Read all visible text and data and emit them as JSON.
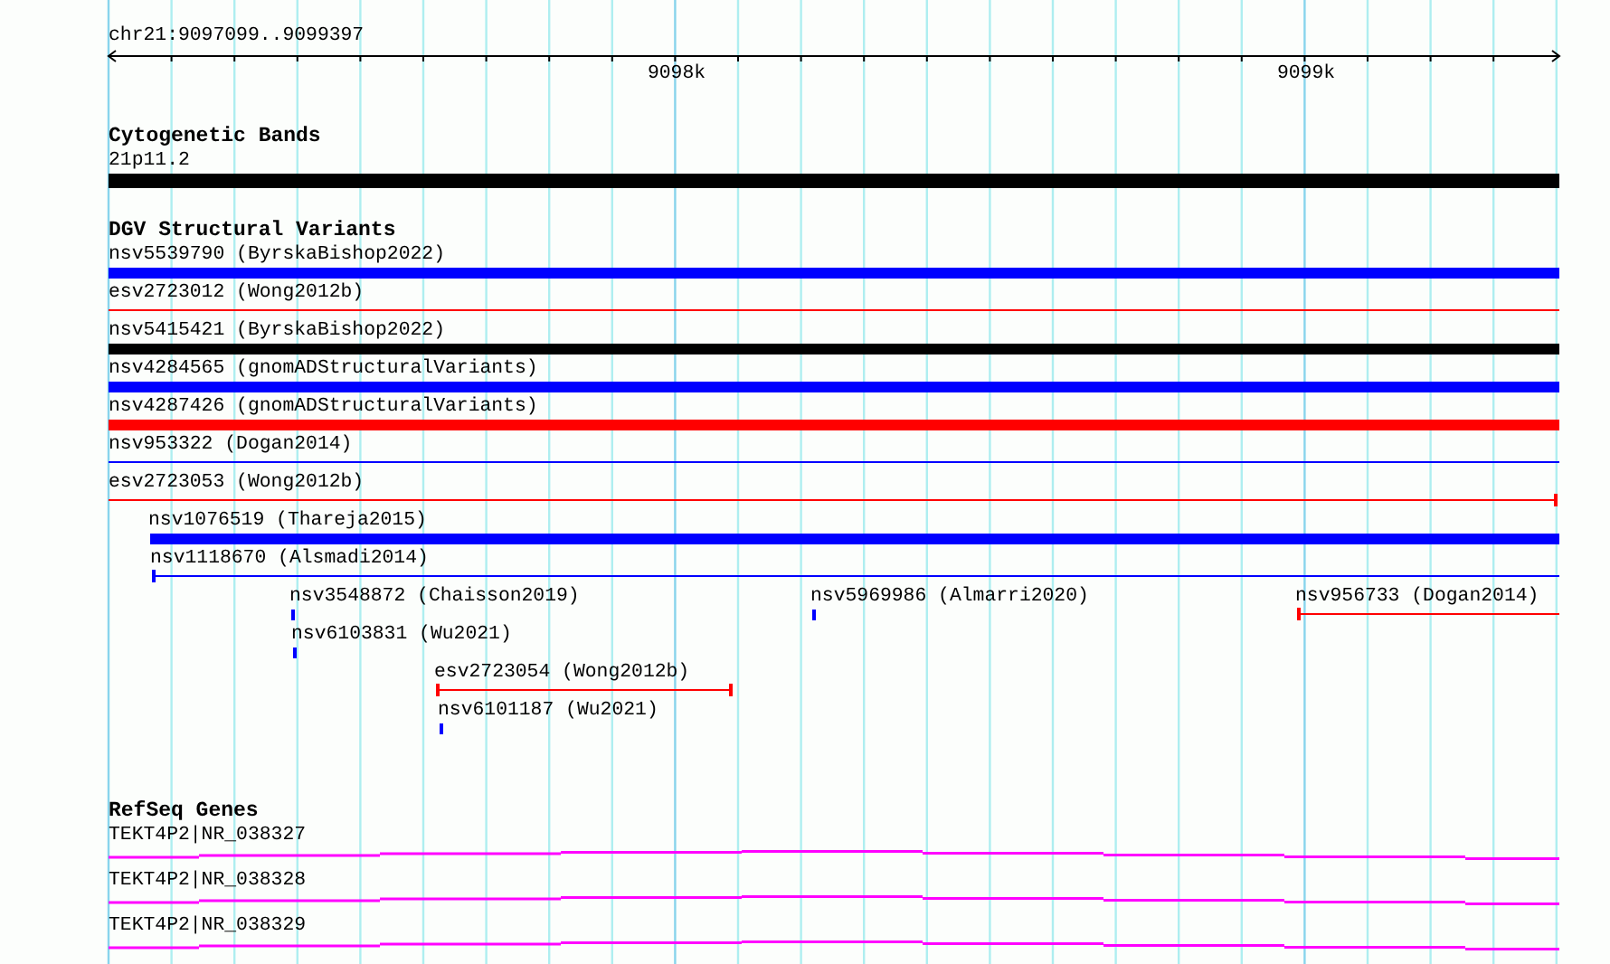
{
  "ruler": {
    "location": "chr21:9097099..9099397",
    "tick_labels": [
      "9098k",
      "9099k"
    ]
  },
  "tracks": [
    {
      "title": "Cytogenetic Bands",
      "rows": [
        [
          {
            "label": "21p11.2",
            "kind": "band",
            "color": "#000000"
          }
        ]
      ]
    },
    {
      "title": "DGV Structural Variants",
      "rows": [
        [
          {
            "label": "nsv5539790 (ByrskaBishop2022)",
            "kind": "thick",
            "color": "#0000ff"
          }
        ],
        [
          {
            "label": "esv2723012 (Wong2012b)",
            "kind": "line",
            "color": "#ff0000"
          }
        ],
        [
          {
            "label": "nsv5415421 (ByrskaBishop2022)",
            "kind": "thick",
            "color": "#000000"
          }
        ],
        [
          {
            "label": "nsv4284565 (gnomADStructuralVariants)",
            "kind": "thick",
            "color": "#0000ff"
          }
        ],
        [
          {
            "label": "nsv4287426 (gnomADStructuralVariants)",
            "kind": "thick",
            "color": "#ff0000"
          }
        ],
        [
          {
            "label": "nsv953322 (Dogan2014)",
            "kind": "line",
            "color": "#0000ff"
          }
        ],
        [
          {
            "label": "esv2723053 (Wong2012b)",
            "kind": "line",
            "color": "#ff0000"
          }
        ],
        [
          {
            "label": "nsv1076519 (Thareja2015)",
            "kind": "thick",
            "color": "#0000ff"
          }
        ],
        [
          {
            "label": "nsv1118670 (Alsmadi2014)",
            "kind": "line",
            "color": "#0000ff"
          }
        ],
        [
          {
            "label": "nsv3548872 (Chaisson2019)",
            "kind": "thick",
            "color": "#0000ff"
          },
          {
            "label": "nsv5969986 (Almarri2020)",
            "kind": "thick",
            "color": "#0000ff"
          },
          {
            "label": "nsv956733 (Dogan2014)",
            "kind": "line",
            "color": "#ff0000"
          }
        ],
        [
          {
            "label": "nsv6103831 (Wu2021)",
            "kind": "thick",
            "color": "#0000ff"
          }
        ],
        [
          {
            "label": "esv2723054 (Wong2012b)",
            "kind": "line",
            "color": "#ff0000"
          }
        ],
        [
          {
            "label": "nsv6101187 (Wu2021)",
            "kind": "thick",
            "color": "#0000ff"
          }
        ]
      ]
    },
    {
      "title": "RefSeq Genes",
      "rows": [
        [
          {
            "label": "TEKT4P2|NR_038327",
            "kind": "gene",
            "color": "#ff00ff"
          }
        ],
        [
          {
            "label": "TEKT4P2|NR_038328",
            "kind": "gene",
            "color": "#ff00ff"
          }
        ],
        [
          {
            "label": "TEKT4P2|NR_038329",
            "kind": "gene",
            "color": "#ff00ff"
          }
        ]
      ]
    }
  ]
}
